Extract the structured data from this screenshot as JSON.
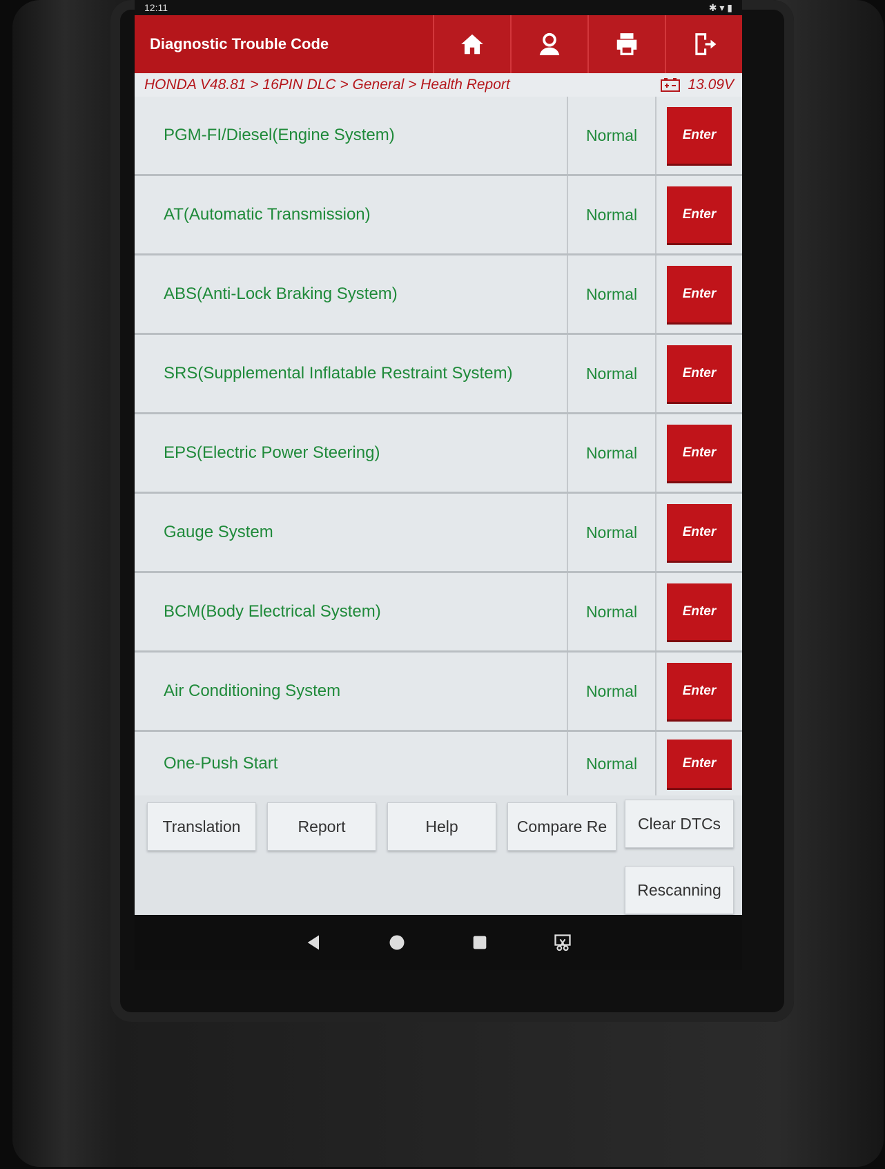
{
  "statusbar": {
    "time": "12:11",
    "icons_right": "✱ ▾ ▮"
  },
  "app": {
    "title": "Diagnostic Trouble Code",
    "top_icons": [
      "home-icon",
      "user-icon",
      "printer-icon",
      "exit-icon"
    ],
    "breadcrumb": "HONDA V48.81 > 16PIN DLC > General > Health Report",
    "voltage": "13.09V",
    "colors": {
      "brand_red": "#b5161b",
      "status_green": "#1f8a3a"
    }
  },
  "systems": [
    {
      "name": "PGM-FI/Diesel(Engine System)",
      "status": "Normal",
      "action": "Enter"
    },
    {
      "name": "AT(Automatic Transmission)",
      "status": "Normal",
      "action": "Enter"
    },
    {
      "name": "ABS(Anti-Lock Braking System)",
      "status": "Normal",
      "action": "Enter"
    },
    {
      "name": "SRS(Supplemental Inflatable Restraint System)",
      "status": "Normal",
      "action": "Enter"
    },
    {
      "name": "EPS(Electric Power Steering)",
      "status": "Normal",
      "action": "Enter"
    },
    {
      "name": "Gauge System",
      "status": "Normal",
      "action": "Enter"
    },
    {
      "name": "BCM(Body Electrical System)",
      "status": "Normal",
      "action": "Enter"
    },
    {
      "name": "Air Conditioning System",
      "status": "Normal",
      "action": "Enter"
    },
    {
      "name": "One-Push Start",
      "status": "Normal",
      "action": "Enter"
    }
  ],
  "buttons": {
    "translation": "Translation",
    "report": "Report",
    "help": "Help",
    "compare": "Compare Re",
    "clear": "Clear DTCs",
    "rescan": "Rescanning"
  },
  "navbar": [
    "back-icon",
    "home-circle-icon",
    "recents-icon",
    "screenshot-icon"
  ]
}
